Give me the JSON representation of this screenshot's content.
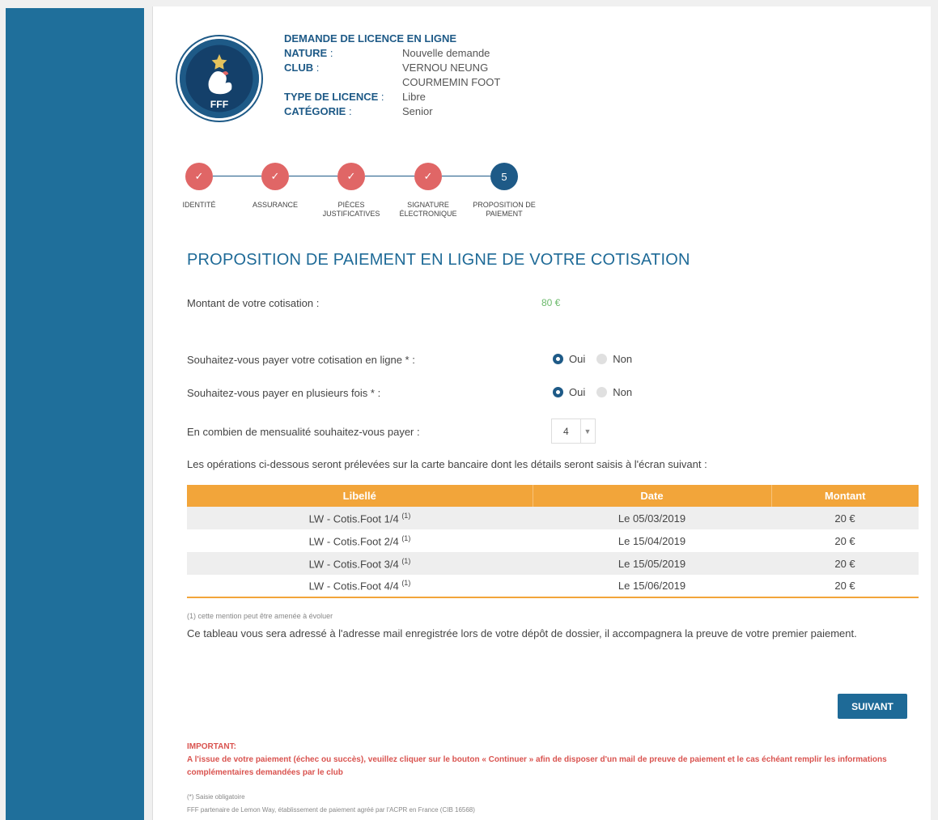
{
  "header": {
    "title": "DEMANDE DE LICENCE EN LIGNE",
    "logo_text": "FFF",
    "fields": [
      {
        "label": "NATURE",
        "sep": " :",
        "value": "Nouvelle demande"
      },
      {
        "label": "CLUB",
        "sep": " :",
        "value": "VERNOU NEUNG"
      },
      {
        "label": "",
        "sep": "",
        "value": "COURMEMIN FOOT"
      },
      {
        "label": "TYPE DE LICENCE",
        "sep": " :",
        "value": "Libre"
      },
      {
        "label": "CATÉGORIE",
        "sep": " :",
        "value": "Senior"
      }
    ]
  },
  "stepper": {
    "steps": [
      {
        "label1": "IDENTITÉ",
        "label2": "",
        "status": "done"
      },
      {
        "label1": "ASSURANCE",
        "label2": "",
        "status": "done"
      },
      {
        "label1": "PIÈCES",
        "label2": "JUSTIFICATIVES",
        "status": "done"
      },
      {
        "label1": "SIGNATURE",
        "label2": "ÉLECTRONIQUE",
        "status": "done"
      },
      {
        "label1": "PROPOSITION DE",
        "label2": "PAIEMENT",
        "status": "current",
        "number": "5"
      }
    ],
    "check_glyph": "✓"
  },
  "section_title": "PROPOSITION DE PAIEMENT EN LIGNE DE VOTRE COTISATION",
  "amount_label": "Montant de votre cotisation :",
  "amount_value": "80 €",
  "q_online": "Souhaitez-vous payer votre cotisation en ligne * :",
  "q_multi": "Souhaitez-vous payer en plusieurs fois * :",
  "opt_yes": "Oui",
  "opt_no": "Non",
  "online_selected": "Oui",
  "multi_selected": "Oui",
  "q_installments": "En combien de mensualité souhaitez-vous payer :",
  "installments_value": "4",
  "ops_text": "Les opérations ci-dessous seront prélevées sur la carte bancaire dont les détails seront saisis à l'écran suivant :",
  "table": {
    "headers": [
      "Libellé",
      "Date",
      "Montant"
    ],
    "rows": [
      {
        "label": "LW - Cotis.Foot 1/4",
        "sup": "(1)",
        "date": "Le 05/03/2019",
        "amount": "20 €"
      },
      {
        "label": "LW - Cotis.Foot 2/4",
        "sup": "(1)",
        "date": "Le 15/04/2019",
        "amount": "20 €"
      },
      {
        "label": "LW - Cotis.Foot 3/4",
        "sup": "(1)",
        "date": "Le 15/05/2019",
        "amount": "20 €"
      },
      {
        "label": "LW - Cotis.Foot 4/4",
        "sup": "(1)",
        "date": "Le 15/06/2019",
        "amount": "20 €"
      }
    ]
  },
  "footnote": "(1) cette mention peut être amenée à évoluer",
  "mail_text": "Ce tableau vous sera adressé à l'adresse mail enregistrée lors de votre dépôt de dossier, il accompagnera la preuve de votre premier paiement.",
  "next_button": "SUIVANT",
  "important_title": "IMPORTANT:",
  "important_text": "A l'issue de votre paiement (échec ou succès), veuillez cliquer sur le bouton « Continuer » afin de disposer d'un mail de preuve de paiement et le cas échéant remplir les informations complémentaires demandées par le club",
  "mandatory_note": "(*) Saisie obligatoire",
  "partner_note": "FFF partenaire de Lemon Way, établissement de paiement agréé par l'ACPR en France (CIB 16568)",
  "colors": {
    "sidebar": "#1f6f9b",
    "accent": "#1e5a87",
    "done": "#e06666",
    "table_header": "#f2a53a",
    "amount": "#6cba6c",
    "warning": "#d9534f"
  }
}
